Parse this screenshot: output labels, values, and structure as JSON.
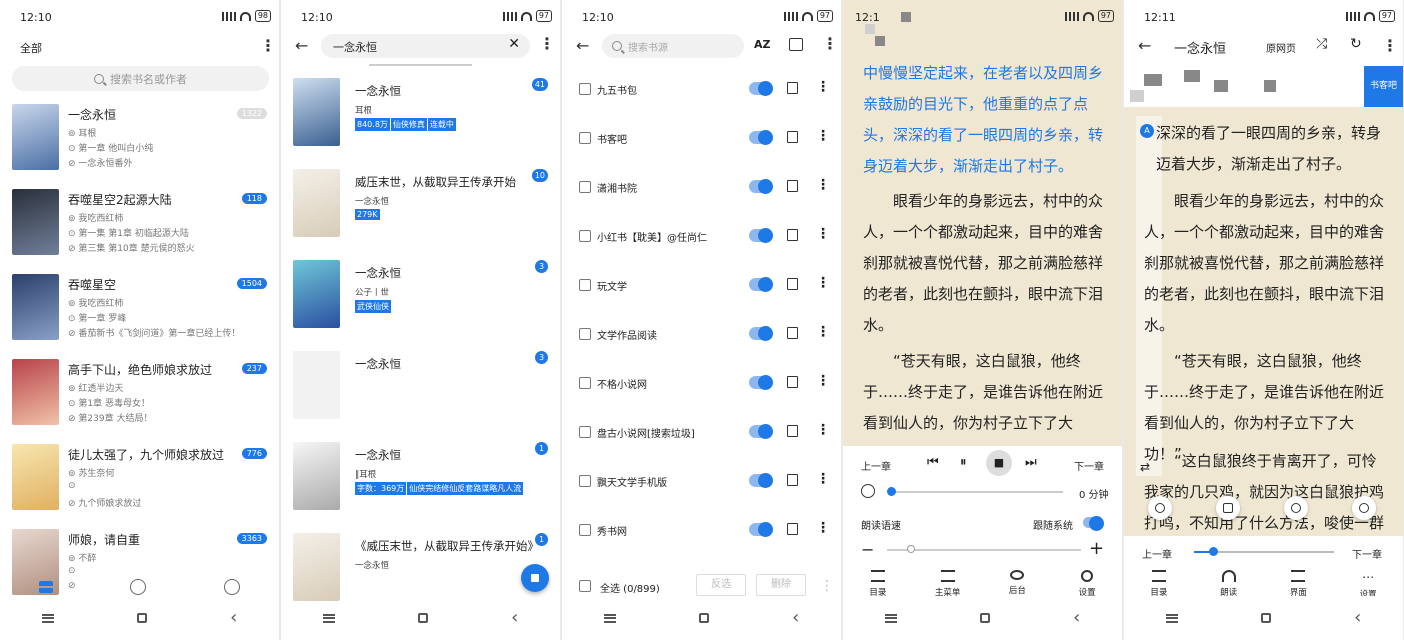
{
  "status": {
    "time1": "12:10",
    "time2": "12:10",
    "time3": "12:10",
    "time4": "12:1",
    "time5": "12:11",
    "battery1": "98",
    "battery2": "97",
    "battery3": "97",
    "battery4": "97",
    "battery5": "97"
  },
  "shelf": {
    "title": "全部",
    "search_placeholder": "搜索书名或作者",
    "books": [
      {
        "title": "一念永恒",
        "author": "耳根",
        "line1": "第一章 他叫白小纯",
        "line2": "一念永恒番外",
        "count": "1322",
        "count_gray": true
      },
      {
        "title": "吞噬星空2起源大陆",
        "author": "我吃西红柿",
        "line1": "第一集 第1章 初临起源大陆",
        "line2": "第三集 第10章 楚元侯的怒火",
        "count": "118"
      },
      {
        "title": "吞噬星空",
        "author": "我吃西红柿",
        "line1": "第一章 罗峰",
        "line2": "番茄新书《飞剑问道》第一章已经上传！",
        "count": "1504"
      },
      {
        "title": "高手下山，绝色师娘求放过",
        "author": "红透半边天",
        "line1": "第1章 恶毒母女！",
        "line2": "第239章 大结局！",
        "count": "237"
      },
      {
        "title": "徒儿太强了，九个师娘求放过",
        "author": "苏生奈何",
        "line1": "",
        "line2": "九个师娘求放过",
        "count": "776"
      },
      {
        "title": "师娘，请自重",
        "author": "不醉",
        "line1": "",
        "line2": "",
        "count": "3363"
      }
    ]
  },
  "search": {
    "query": "一念永恒",
    "results": [
      {
        "title": "一念永恒",
        "author": "耳根",
        "tags": [
          "840.8万",
          "仙侠修真",
          "连载中"
        ],
        "count": "41"
      },
      {
        "title": "威压末世，从截取异王传承开始",
        "author": "一念永恒",
        "tags": [
          "279K"
        ],
        "count": "10"
      },
      {
        "title": "一念永恒",
        "author": "公子丨世",
        "tags": [
          "武侠仙侠"
        ],
        "count": "3"
      },
      {
        "title": "一念永恒",
        "author": "",
        "tags": [],
        "count": "3"
      },
      {
        "title": "一念永恒",
        "author": "‖耳根",
        "tags": [
          "字数：369万",
          "仙侠完结修仙反套路谋略凡人流"
        ],
        "count": "1"
      },
      {
        "title": "《威压末世，从截取异王传承开始》",
        "author": "一念永恒",
        "tags": [],
        "count": "1"
      }
    ]
  },
  "sources": {
    "search_placeholder": "搜索书源",
    "sort_label": "AZ",
    "items": [
      "九五书包",
      "书客吧",
      "潇湘书院",
      "小红书【耽美】@任尚仁",
      "玩文学",
      "文学作品阅读",
      "不格小说网",
      "盘古小说网[搜索垃圾]",
      "飘天文学手机版",
      "秀书网"
    ],
    "select_all": "全选 (0/899)",
    "invert": "反选",
    "delete": "删除"
  },
  "reader1": {
    "blue_text": "中慢慢坚定起来，在老者以及四周乡亲鼓励的目光下，他重重的点了点头，深深的看了一眼四周的乡亲，转身迈着大步，渐渐走出了村子。",
    "para1": "眼看少年的身影远去，村中的众人，一个个都激动起来，目中的难舍刹那就被喜悦代替，那之前满脸慈祥的老者，此刻也在颤抖，眼中流下泪水。",
    "para2": "“苍天有眼，这白鼠狼，他终于……终于走了，是谁告诉他在附近看到仙人的，你为村子立下了大功！”",
    "prev": "上一章",
    "next": "下一章",
    "timer": "0 分钟",
    "speed": "朗读语速",
    "follow": "跟随系统",
    "menu": [
      "目录",
      "主菜单",
      "后台",
      "设置"
    ]
  },
  "reader2": {
    "title": "一念永恒",
    "origin": "原网页",
    "side_source": "书客吧",
    "text1": "深深的看了一眼四周的乡亲，转身迈着大步，渐渐走出了村子。",
    "para1": "眼看少年的身影远去，村中的众人，一个个都激动起来，目中的难舍刹那就被喜悦代替，那之前满脸慈祥的老者，此刻也在颤抖，眼中流下泪水。",
    "para2": "“苍天有眼，这白鼠狼，他终于……终于走了，是谁告诉他在附近看到仙人的，你为村子立下了大功！”",
    "para3": "“这白鼠狼终于肯离开了，可怜我家的几只鸡，就因为这白鼠狼护鸡打鸣，不知用了什么方法，唆使一群",
    "prev": "上一章",
    "next": "下一章",
    "menu": [
      "目录",
      "朗读",
      "界面",
      "设置"
    ]
  },
  "colors": {
    "accent": "#1e78e6",
    "reader_bg": "#efe7d2"
  }
}
